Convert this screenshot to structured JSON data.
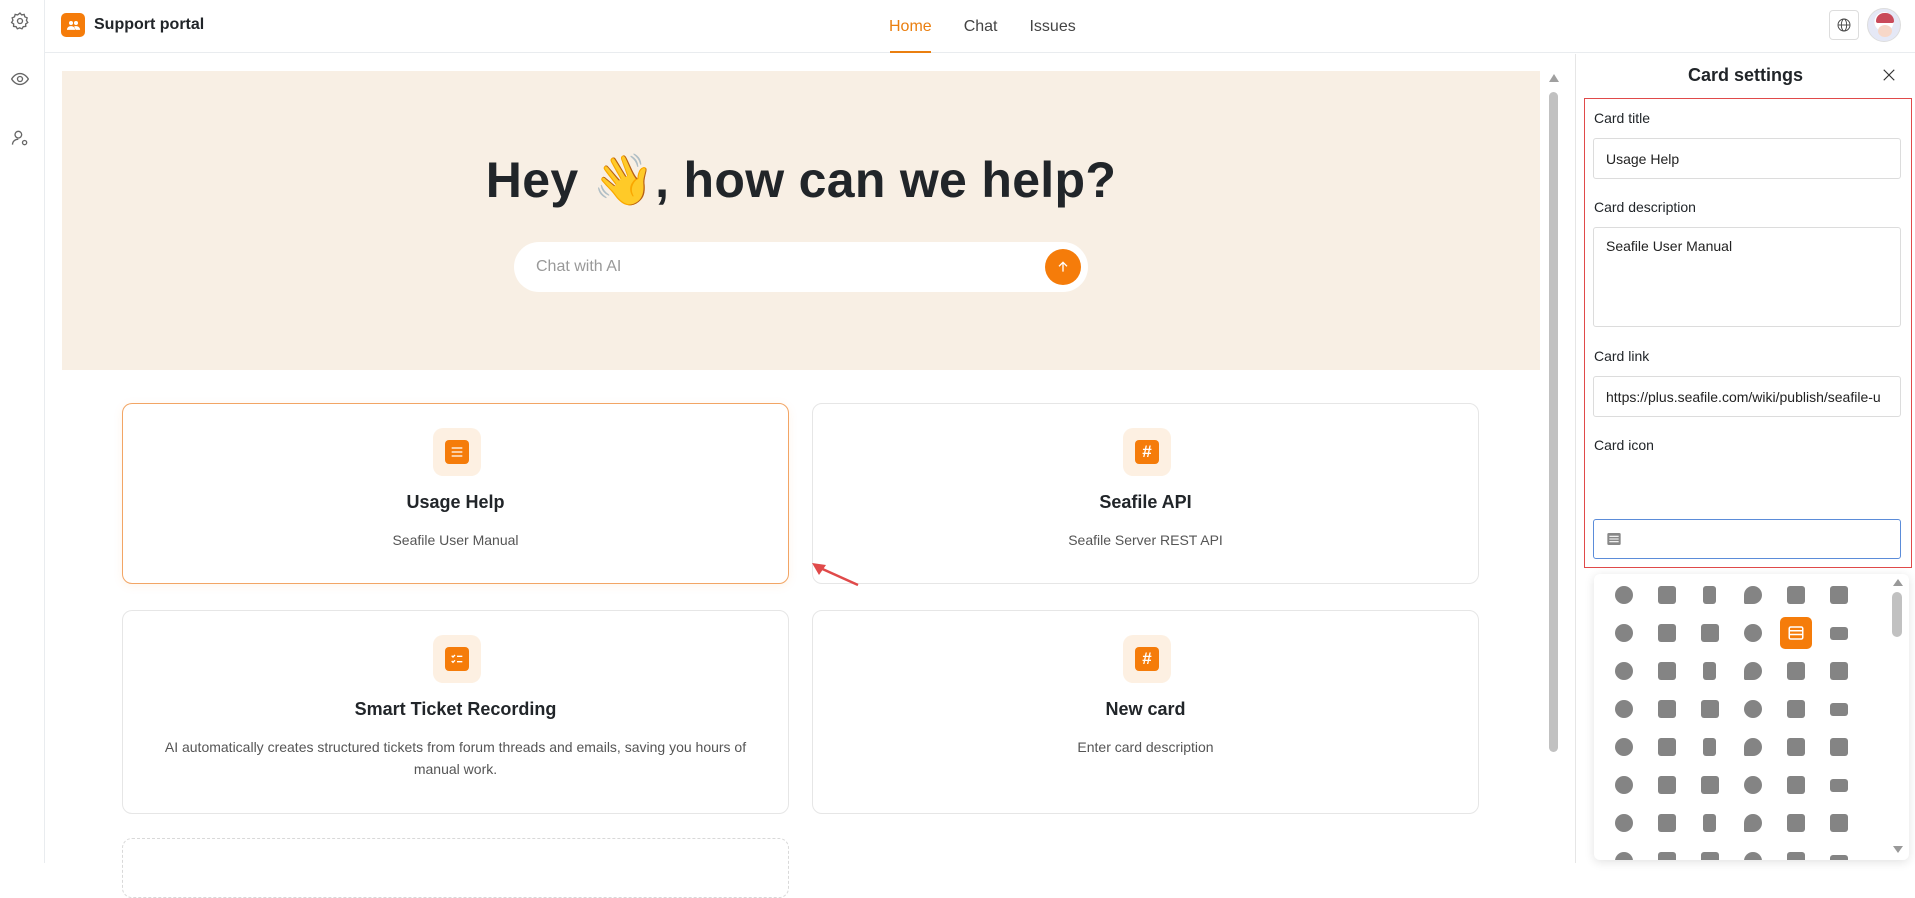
{
  "app": {
    "name": "Support portal",
    "brand_color": "#f57c0a"
  },
  "nav": {
    "tabs": [
      {
        "label": "Home",
        "active": true
      },
      {
        "label": "Chat",
        "active": false
      },
      {
        "label": "Issues",
        "active": false
      }
    ]
  },
  "rail": {
    "icons": [
      "gear-icon",
      "eye-icon",
      "user-settings-icon"
    ]
  },
  "hero": {
    "title": "Hey 👋, how can we help?",
    "search_placeholder": "Chat with AI",
    "send_icon": "arrow-up-icon"
  },
  "cards": [
    {
      "title": "Usage Help",
      "description": "Seafile User Manual",
      "icon": "list-icon",
      "selected": true
    },
    {
      "title": "Seafile API",
      "description": "Seafile Server REST API",
      "icon": "hashtag-icon",
      "selected": false
    },
    {
      "title": "Smart Ticket Recording",
      "description": "AI automatically creates structured tickets from forum threads and emails, saving you hours of manual work.",
      "icon": "checklist-icon",
      "selected": false
    },
    {
      "title": "New card",
      "description": "Enter card description",
      "icon": "hashtag-icon",
      "selected": false
    }
  ],
  "panel": {
    "title": "Card settings",
    "fields": {
      "title_label": "Card title",
      "title_value": "Usage Help",
      "description_label": "Card description",
      "description_value": "Seafile User Manual",
      "link_label": "Card link",
      "link_value": "https://plus.seafile.com/wiki/publish/seafile-u",
      "icon_label": "Card icon",
      "icon_value": "list-icon"
    },
    "icon_picker": {
      "selected_icon": "list-icon",
      "icons": [
        "alarm-clock-icon",
        "book-icon",
        "invoice-icon",
        "gear-box-icon",
        "calendar-check-icon",
        "calendar-grid-icon",
        "trend-chart-icon",
        "apps-icon",
        "cube-icon",
        "dollar-icon",
        "list-icon",
        "film-icon",
        "flask-icon",
        "calendar-day-icon",
        "dashboard-icon",
        "hashtag-icon",
        "house-dollar-icon",
        "list-rows-icon",
        "checklist-icon",
        "megaphone-icon",
        "edit-note-icon",
        "tools-icon",
        "phone-icon",
        "presentation-icon",
        "id-card-icon",
        "headset-icon",
        "users-icon",
        "person-card-icon",
        "team-icon",
        "contact-book-icon",
        "airplay-icon",
        "archive-icon",
        "asterisk-icon",
        "radio-icon",
        "battery-icon",
        "bell-icon",
        "bluetooth-icon",
        "open-book-icon",
        "reading-book-icon",
        "bookmark-icon",
        "books-icon",
        "nodes-icon",
        "inbox-download-icon",
        "inbox-upload-icon",
        "cards-icon",
        "calculator-icon",
        "certificate-icon",
        "laptop-icon"
      ]
    }
  }
}
